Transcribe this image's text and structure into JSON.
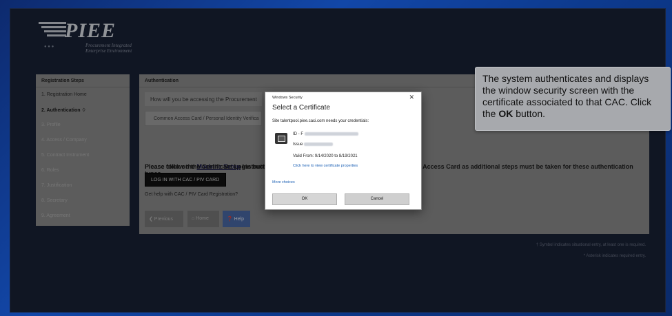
{
  "logo": {
    "name": "PIEE",
    "subtitle_line1": "Procurement Integrated",
    "subtitle_line2": "Enterprise Environment"
  },
  "sidebar": {
    "title": "Registration Steps",
    "items": [
      {
        "label": "1. Registration Home",
        "state": "normal"
      },
      {
        "label": "2. Authentication ♢",
        "state": "active"
      },
      {
        "label": "3. Profile",
        "state": "muted"
      },
      {
        "label": "4. Access / Company",
        "state": "muted"
      },
      {
        "label": "5. Contract Instrument",
        "state": "muted"
      },
      {
        "label": "6. Roles",
        "state": "muted"
      },
      {
        "label": "7. Justification",
        "state": "muted"
      },
      {
        "label": "8. Secretary",
        "state": "muted"
      },
      {
        "label": "9. Agreement",
        "state": "muted"
      }
    ]
  },
  "main": {
    "title": "Authentication",
    "question": "How will you be accessing the Procurement",
    "question_suffix": "to",
    "select_value": "Common Access Card / Personal Identity Verifica",
    "follow_prefix": "Please follow the ",
    "follow_link": "Machine Setup",
    "follow_suffix": " Instructi",
    "follow_line2": "types.",
    "follow_right": "on Access Card as additional steps must be taken for these authentication",
    "click_text": "Please click on the Certificate Login button",
    "cac_button": "LOG IN WITH CAC / PIV CARD",
    "help_link": "Get help with CAC / PIV Card Registration?",
    "nav": {
      "previous": "❮ Previous",
      "home": "⌂ Home",
      "help": "❓ Help"
    },
    "footnote_1": "† Symbol indicates situational entry, at least one is required.",
    "footnote_2": "* Asterisk indicates required entry."
  },
  "dialog": {
    "caption": "Windows Security",
    "close": "✕",
    "title": "Select a Certificate",
    "site_text": "Site talentpool.piee.caci.com needs your credentials:",
    "cert_id_prefix": "ID - F",
    "cert_issuer_prefix": "Issue",
    "valid": "Valid From: 9/14/2020 to 8/19/2021",
    "properties_link": "Click here to view certificate properties",
    "more_choices": "More choices",
    "ok": "OK",
    "cancel": "Cancel"
  },
  "callout": {
    "text_before": "The system authenticates and displays the window security screen with the certificate associated to that CAC. Click the ",
    "bold": "OK",
    "text_after": " button."
  }
}
